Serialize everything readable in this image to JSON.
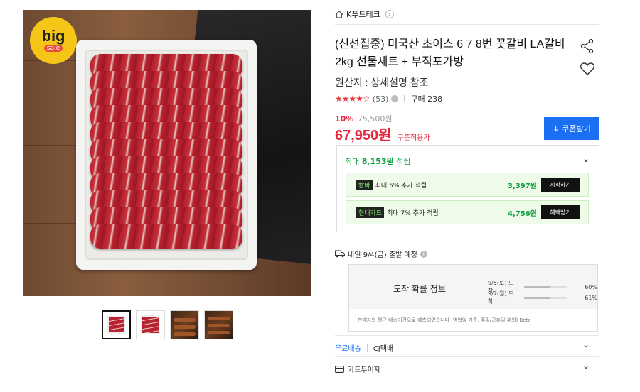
{
  "gallery": {
    "badge_big": "big",
    "badge_sale": "sale",
    "thumbnails": [
      "thumbnail-1",
      "thumbnail-2",
      "thumbnail-3",
      "thumbnail-4"
    ]
  },
  "product": {
    "seller": "K푸드테크",
    "seller_arrow": "›",
    "title": "(신선집중) 미국산 초이스 6 7 8번 꽃갈비 LA갈비 2kg 선물세트 + 부직포가방",
    "origin": "원산지 : 상세설명 참조",
    "stars": "★★★★☆",
    "review_count": "(53)",
    "info_glyph": "i",
    "purchase": "구매 238",
    "discount_rate": "10%",
    "original_price": "75,500원",
    "price": "67,950원",
    "price_note": "쿠폰적용가",
    "coupon_button": "쿠폰받기",
    "coupon_icon": "↓"
  },
  "points": {
    "prefix": "최대 ",
    "amount": "8,153원",
    "suffix": " 적립",
    "chevron": "⌄",
    "offers": [
      {
        "tag": "빰바",
        "text": "최대 5% 추가 적립",
        "amount": "3,397원",
        "button": "시작하기"
      },
      {
        "tag": "현대카드",
        "text": "최대 7% 추가 적립",
        "amount": "4,756원",
        "button": "혜택받기"
      }
    ]
  },
  "shipping": {
    "eta": "내일 9/4(금) 출발 예정",
    "arrival_title": "도착 확률 정보",
    "arrivals": [
      {
        "date": "9/5(토) 도착",
        "percent": "60%",
        "value": 0.6
      },
      {
        "date": "9/7(월) 도착",
        "percent": "61%",
        "value": 0.61
      }
    ],
    "note": "판매자의 평균 배송기간으로 예측되었습니다 (영업일 기준, 주말/공휴일 제외) Beta",
    "free_label": "무료배송",
    "courier": "CJ택배",
    "card_label": "카드무이자",
    "chevron": "⌄"
  },
  "colors": {
    "accent_red": "#e6263b",
    "accent_blue": "#1a6ff2",
    "accent_green": "#11a043"
  },
  "icons": {
    "home": "home-icon",
    "share": "share-icon",
    "heart": "heart-icon",
    "truck": "truck-icon",
    "card": "card-icon"
  }
}
